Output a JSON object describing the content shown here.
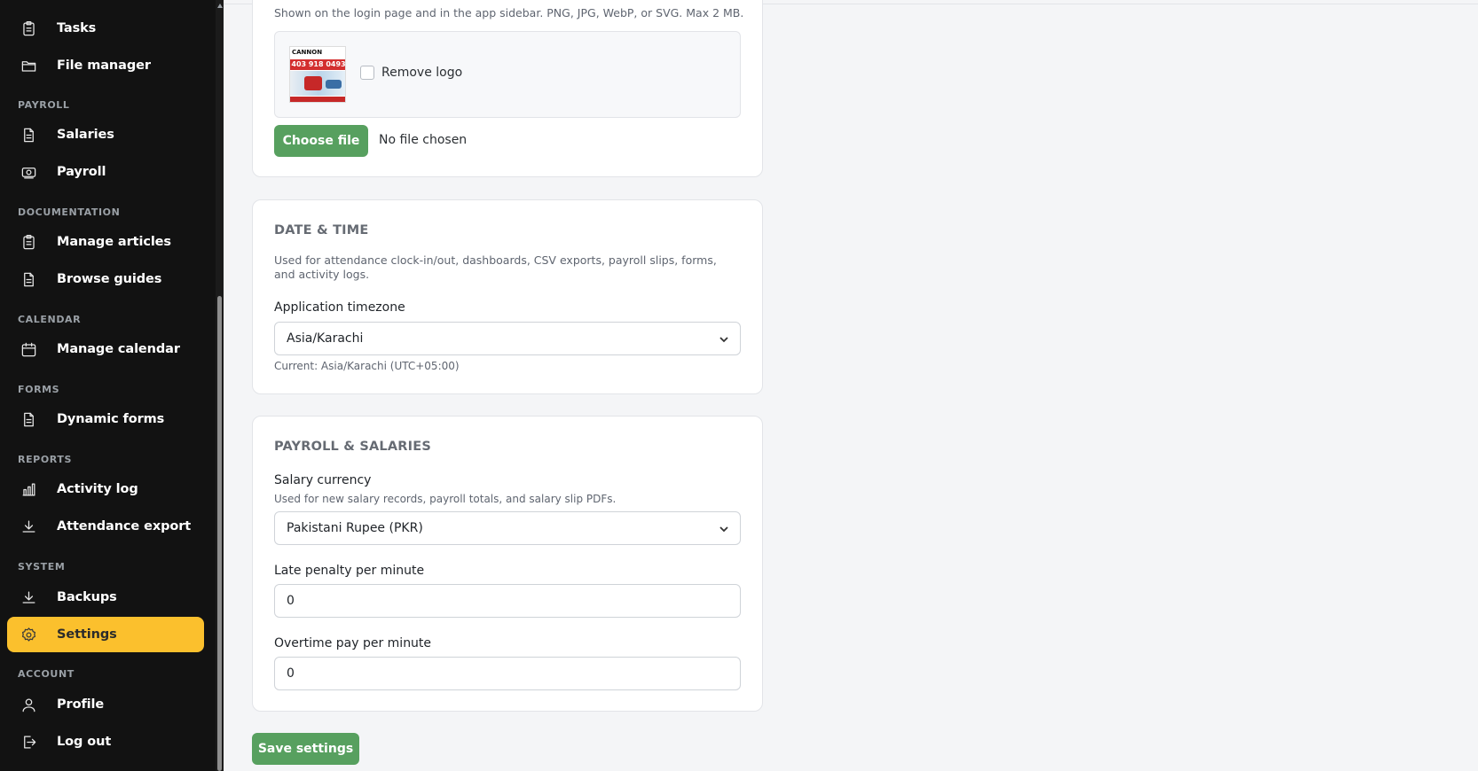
{
  "sidebar": {
    "items": [
      {
        "label": "Tasks",
        "icon": "clipboard-icon"
      },
      {
        "label": "File manager",
        "icon": "folder-icon"
      },
      {
        "label": "Salaries",
        "icon": "document-icon"
      },
      {
        "label": "Payroll",
        "icon": "banknote-icon"
      },
      {
        "label": "Manage articles",
        "icon": "clipboard-icon"
      },
      {
        "label": "Browse guides",
        "icon": "document-icon"
      },
      {
        "label": "Manage calendar",
        "icon": "calendar-icon"
      },
      {
        "label": "Dynamic forms",
        "icon": "document-icon"
      },
      {
        "label": "Activity log",
        "icon": "bar-chart-icon"
      },
      {
        "label": "Attendance export",
        "icon": "download-icon"
      },
      {
        "label": "Backups",
        "icon": "download-icon"
      },
      {
        "label": "Settings",
        "icon": "gear-icon"
      },
      {
        "label": "Profile",
        "icon": "user-icon"
      },
      {
        "label": "Log out",
        "icon": "logout-icon"
      }
    ],
    "sections": [
      "PAYROLL",
      "DOCUMENTATION",
      "CALENDAR",
      "FORMS",
      "REPORTS",
      "SYSTEM",
      "ACCOUNT"
    ],
    "active_item": "Settings"
  },
  "branding": {
    "logo_help": "Shown on the login page and in the app sidebar. PNG, JPG, WebP, or SVG. Max 2 MB.",
    "logo_text_top": "CANNON",
    "logo_phone": "403 918 0493",
    "remove_logo_label": "Remove logo",
    "choose_file_label": "Choose file",
    "file_status": "No file chosen"
  },
  "datetime": {
    "title": "DATE & TIME",
    "description": "Used for attendance clock-in/out, dashboards, CSV exports, payroll slips, forms, and activity logs.",
    "timezone_label": "Application timezone",
    "timezone_value": "Asia/Karachi",
    "timezone_current": "Current: Asia/Karachi (UTC+05:00)"
  },
  "payroll": {
    "title": "PAYROLL & SALARIES",
    "currency_label": "Salary currency",
    "currency_help": "Used for new salary records, payroll totals, and salary slip PDFs.",
    "currency_value": "Pakistani Rupee (PKR)",
    "late_penalty_label": "Late penalty per minute",
    "late_penalty_value": "0",
    "overtime_label": "Overtime pay per minute",
    "overtime_value": "0"
  },
  "actions": {
    "save_label": "Save settings"
  },
  "colors": {
    "sidebar_bg": "#121212",
    "active_accent": "#fbc02d",
    "primary_button": "#57a05f"
  }
}
